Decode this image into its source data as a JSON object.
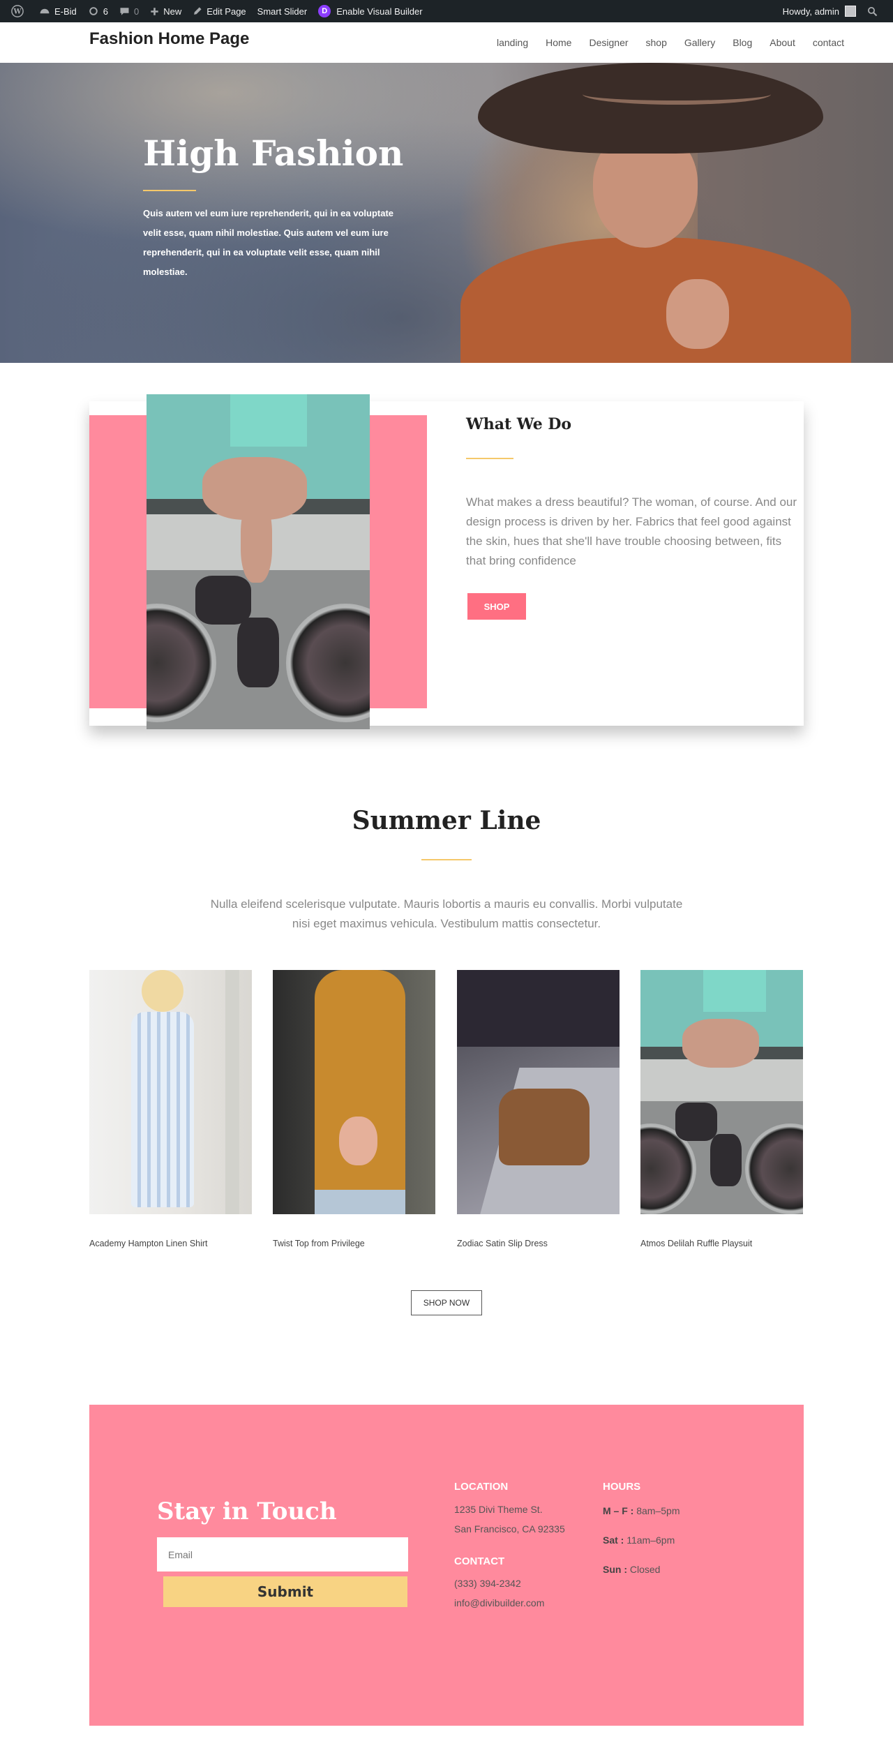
{
  "admin_bar": {
    "site_name": "E-Bid",
    "updates_count": "6",
    "comments_count": "0",
    "new_label": "New",
    "edit_page_label": "Edit Page",
    "smart_slider_label": "Smart Slider",
    "divi_badge": "D",
    "visual_builder_label": "Enable Visual Builder",
    "greeting": "Howdy, admin"
  },
  "header": {
    "logo": "Fashion Home Page",
    "nav": [
      "landing",
      "Home",
      "Designer",
      "shop",
      "Gallery",
      "Blog",
      "About",
      "contact"
    ]
  },
  "hero": {
    "title": "High Fashion",
    "text": "Quis autem vel eum iure reprehenderit, qui in ea voluptate velit esse, quam nihil molestiae. Quis autem vel eum iure reprehenderit, qui in ea voluptate velit esse, quam nihil molestiae."
  },
  "what_we_do": {
    "title": "What We Do",
    "text": "What makes a dress beautiful? The woman, of course. And our design process is driven by her. Fabrics that feel good against the skin, hues that she'll have trouble choosing between, fits that bring confidence",
    "button": "SHOP"
  },
  "summer_line": {
    "title": "Summer Line",
    "text": "Nulla eleifend scelerisque vulputate. Mauris lobortis a mauris eu convallis. Morbi vulputate nisi eget maximus vehicula. Vestibulum mattis consectetur.",
    "products": [
      {
        "name": "Academy Hampton Linen Shirt"
      },
      {
        "name": "Twist Top from Privilege"
      },
      {
        "name": "Zodiac Satin Slip Dress"
      },
      {
        "name": "Atmos Delilah Ruffle Playsuit"
      }
    ],
    "shop_now": "SHOP NOW"
  },
  "contact": {
    "title": "Stay in Touch",
    "email_placeholder": "Email",
    "submit": "Submit",
    "location_head": "LOCATION",
    "address_1": "1235 Divi Theme St.",
    "address_2": "San Francisco, CA 92335",
    "contact_head": "CONTACT",
    "phone": "(333) 394-2342",
    "email": "info@divibuilder.com",
    "hours_head": "HOURS",
    "hours": [
      {
        "day": "M – F :",
        "time": " 8am–5pm"
      },
      {
        "day": "Sat :",
        "time": " 11am–6pm"
      },
      {
        "day": "Sun :",
        "time": " Closed"
      }
    ]
  },
  "colors": {
    "accent_pink": "#ff8a9d",
    "button_pink": "#ff6f82",
    "gold": "#f5c86a",
    "submit_yellow": "#f8d383",
    "admin_bar": "#1d2327"
  }
}
